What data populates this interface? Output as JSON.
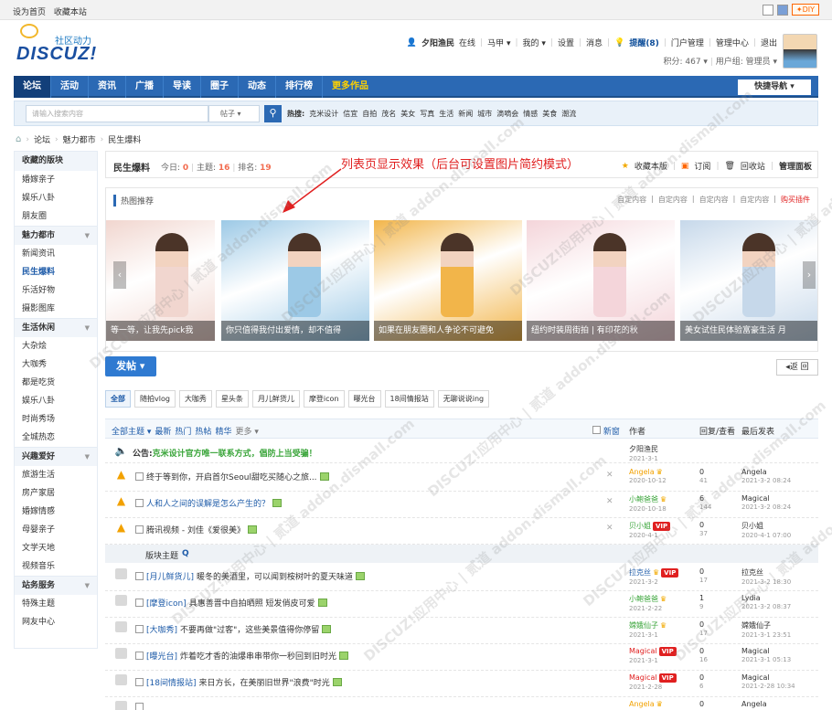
{
  "topbar": {
    "set_home": "设为首页",
    "bookmark": "收藏本站",
    "diy": "✦DIY"
  },
  "header": {
    "logo_text": "DISCUZ!",
    "logo_tagline": "社区动力",
    "user": {
      "name": "夕阳渔民",
      "status": "在线",
      "links": [
        "马甲 ▾",
        "我的 ▾",
        "设置",
        "消息"
      ],
      "reminder": "提醒(8)",
      "links2": [
        "门户管理",
        "管理中心",
        "退出"
      ],
      "points": "积分: 467 ▾",
      "group": "用户组: 管理员 ▾"
    }
  },
  "nav": {
    "items": [
      "论坛",
      "活动",
      "资讯",
      "广播",
      "导读",
      "圈子",
      "动态",
      "排行榜"
    ],
    "more": "更多作品",
    "quick": "快捷导航 ▾"
  },
  "search": {
    "placeholder": "请输入搜索内容",
    "select": "帖子 ▾",
    "hot_label": "热搜:",
    "hot": [
      "克米设计",
      "信宜",
      "自拍",
      "茂名",
      "美女",
      "写真",
      "生活",
      "新闻",
      "城市",
      "滴嘀会",
      "情感",
      "美食",
      "潮流"
    ]
  },
  "breadcrumb": [
    "论坛",
    "魅力都市",
    "民生爆料"
  ],
  "sidebar": [
    {
      "group": "收藏的版块",
      "items": [
        "婚嫁亲子",
        "娱乐八卦",
        "朋友圈"
      ]
    },
    {
      "group": "魅力都市",
      "items": [
        "新闻资讯",
        "民生爆料",
        "乐活好物",
        "摄影图库"
      ]
    },
    {
      "group": "生活休闲",
      "items": [
        "大杂烩",
        "大咖秀",
        "都是吃货",
        "娱乐八卦",
        "时尚秀场",
        "全城热恋"
      ]
    },
    {
      "group": "兴趣爱好",
      "items": [
        "旅游生活",
        "房产家居",
        "婚嫁情感",
        "母婴亲子",
        "文学天地",
        "视频音乐"
      ]
    },
    {
      "group": "站务服务",
      "items": [
        "特殊主题",
        "网友中心"
      ]
    }
  ],
  "sidebar_current": "民生爆料",
  "forum": {
    "title": "民生爆料",
    "today_label": "今日:",
    "today": "0",
    "threads_label": "主题:",
    "threads": "16",
    "rank_label": "排名:",
    "rank": "19",
    "actions": [
      "收藏本版",
      "订阅",
      "回收站",
      "管理面板"
    ],
    "annotation": "列表页显示效果（后台可设置图片简约模式）"
  },
  "hotrec": {
    "title": "热图推荐",
    "links": [
      "自定内容",
      "自定内容",
      "自定内容",
      "自定内容"
    ],
    "buy": "购买插件",
    "captions": [
      "等一等，让我先pick我",
      "你只值得我付出爱情，却不值得",
      "如果在朋友圈和人争论不可避免",
      "纽约时装周街拍 | 有印花的秋",
      "美女试住民体验富豪生活 月"
    ],
    "colors": [
      "#f1d6cf",
      "#9cc9e6",
      "#f2b54a",
      "#f4d5da",
      "#c6d8ea"
    ]
  },
  "post_button": "发帖 ▾",
  "back_button": "◂返 回",
  "types": [
    "全部",
    "随拍vlog",
    "大咖秀",
    "星头条",
    "月儿鲜货儿",
    "摩登icon",
    "曝光台",
    "18间情报站",
    "无聊说说ing"
  ],
  "list_header": {
    "filters": [
      "全部主题 ▾",
      "最新",
      "热门",
      "热帖",
      "精华",
      "更多 ▾"
    ],
    "new_window": "新窗",
    "author": "作者",
    "replies": "回复/查看",
    "last": "最后发表"
  },
  "announcement": {
    "label": "公告:",
    "text": "克米设计官方唯一联系方式，倡防上当受骗！",
    "author": "夕阳渔民",
    "date": "2021-3-1"
  },
  "sticky": [
    {
      "title": "终于等到你，开启首尔Seoul甜吃买随心之旅...",
      "author": "Angela",
      "date": "2020-10-12",
      "replies": "0",
      "views": "41",
      "last_author": "Angela",
      "last_date": "2021-3-2 08:24"
    },
    {
      "title": "人和人之间的误解是怎么产生的？",
      "author": "小鲍爸爸",
      "date": "2020-10-18",
      "replies": "6",
      "views": "144",
      "last_author": "Magical",
      "last_date": "2021-3-2 08:24"
    },
    {
      "title": "腾讯视频 - 刘佳《爱很美》",
      "author": "贝小姐",
      "date": "2020-4-1",
      "replies": "0",
      "views": "37",
      "last_author": "贝小姐",
      "last_date": "2020-4-1 07:00"
    }
  ],
  "section_label": "版块主题",
  "threads": [
    {
      "tag": "[月儿鲜货儿]",
      "title": "暖冬的美酒里，可以闻到桉树叶的夏天味道",
      "author": "拉克丝",
      "date": "2021-3-2",
      "replies": "0",
      "views": "17",
      "last_author": "拉克丝",
      "last_date": "2021-3-2 18:30"
    },
    {
      "tag": "[摩登icon]",
      "title": "具惠善晋中自拍晒照 短发俏皮可爱",
      "author": "小鲍爸爸",
      "date": "2021-2-22",
      "replies": "1",
      "views": "9",
      "last_author": "Lydia",
      "last_date": "2021-3-2 08:37"
    },
    {
      "tag": "[大咖秀]",
      "title": "不要再做\"过客\"，这些美景值得你停留",
      "author": "嫦娥仙子",
      "date": "2021-3-1",
      "replies": "0",
      "views": "17",
      "last_author": "嫦娥仙子",
      "last_date": "2021-3-1 23:51"
    },
    {
      "tag": "[曝光台]",
      "title": "炸着吃才香的油爆串串带你一秒回到旧时光",
      "author": "Magical",
      "date": "2021-3-1",
      "replies": "0",
      "views": "16",
      "last_author": "Magical",
      "last_date": "2021-3-1 05:13"
    },
    {
      "tag": "[18间情报站]",
      "title": "来日方长，在美丽旧世界\"浪费\"时光",
      "author": "Magical",
      "date": "2021-2-28",
      "replies": "0",
      "views": "6",
      "last_author": "Magical",
      "last_date": "2021-2-28 10:34"
    },
    {
      "tag": "",
      "title": "",
      "author": "Angela",
      "date": "",
      "replies": "0",
      "views": "",
      "last_author": "Angela",
      "last_date": ""
    }
  ],
  "badges": {
    "vip": "VIP"
  },
  "watermark": "DISCUZ!应用中心 | 贰道 addon.dismall.com"
}
